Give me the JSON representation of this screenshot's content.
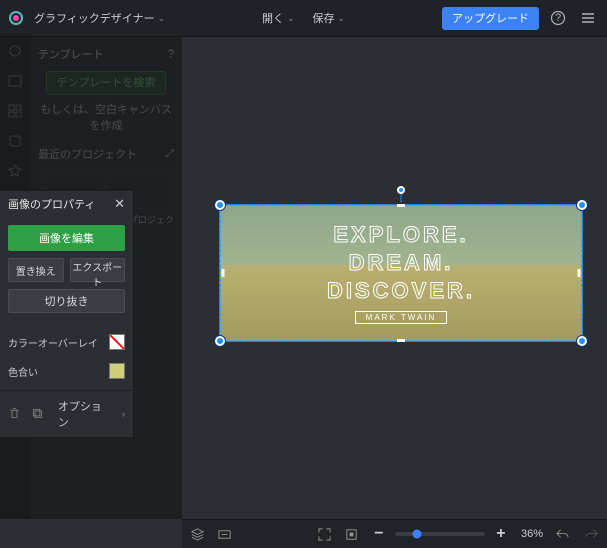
{
  "topbar": {
    "app_title": "グラフィックデザイナー",
    "menu": {
      "open": "開く",
      "save": "保存"
    },
    "upgrade": "アップグレード"
  },
  "sidebar": {
    "templates_heading": "テンプレート",
    "search_templates_btn": "テンプレートを検索",
    "blank_canvas_text": "もしくは、空白キャンバスを作成",
    "recent_heading": "最近のプロジェクト",
    "recent_item": "プロジェク"
  },
  "panel": {
    "title": "画像のプロパティ",
    "edit_image_btn": "画像を編集",
    "replace_btn": "置き換え",
    "export_btn": "エクスポート",
    "crop_btn": "切り抜き",
    "overlay_label": "カラーオーバーレイ",
    "tint_label": "色合い",
    "options": "オプション"
  },
  "artwork": {
    "line1": "EXPLORE.",
    "line2": "DREAM.",
    "line3": "DISCOVER.",
    "author": "MARK TWAIN"
  },
  "bottombar": {
    "zoom_percent": "36%"
  },
  "colors": {
    "accent_blue": "#3b82f6",
    "accent_green": "#2ea043",
    "tint_swatch": "#cfcf7a"
  }
}
